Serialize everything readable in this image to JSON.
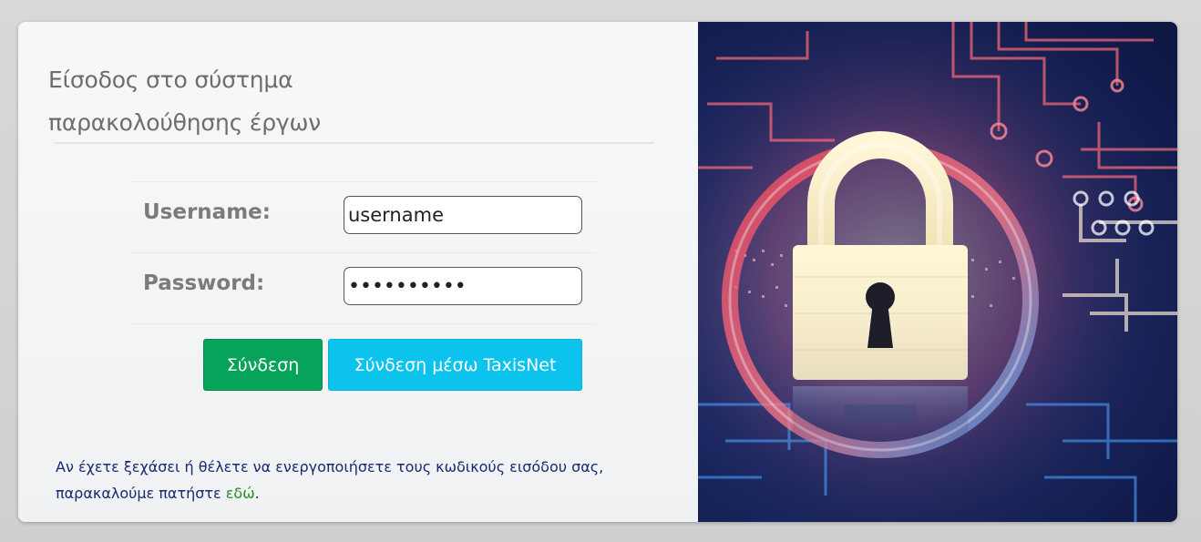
{
  "page": {
    "title_line1": "Είσοδος στο σύστημα",
    "title_line2": "παρακολούθησης έργων"
  },
  "form": {
    "username_label": "Username:",
    "username_value": "username",
    "password_label": "Password:",
    "password_value": "••••••••••"
  },
  "buttons": {
    "login_label": "Σύνδεση",
    "taxisnet_label": "Σύνδεση μέσω TaxisNet"
  },
  "help": {
    "text_line1": "Αν έχετε ξεχάσει ή θέλετε να ενεργοποιήσετε τους κωδικούς εισόδου σας,",
    "text_line2_prefix": "παρακαλούμε πατήστε",
    "link_label": "εδώ",
    "text_line2_suffix": "."
  },
  "image": {
    "icon": "padlock-circuit-image"
  },
  "colors": {
    "login_button": "#08a35b",
    "taxisnet_button": "#0cc3ee",
    "help_text": "#1a2a72",
    "help_link": "#2a8a2a"
  }
}
